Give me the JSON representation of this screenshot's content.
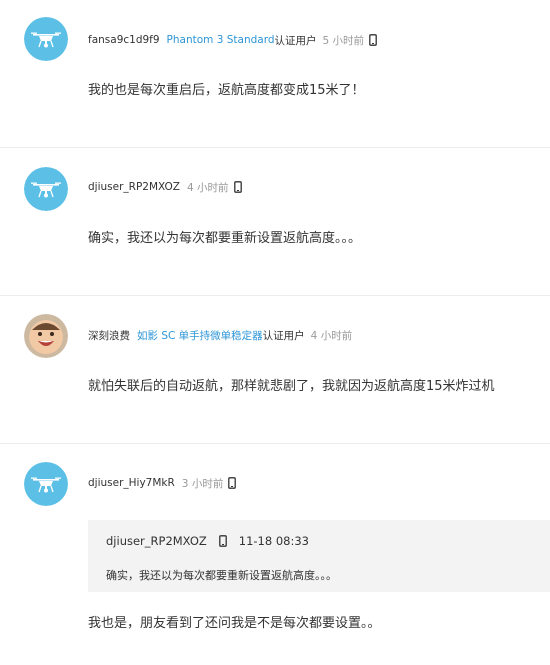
{
  "comments": [
    {
      "username": "fansa9c1d9f9",
      "device": "Phantom 3 Standard",
      "badge": "认证用户",
      "time": "5 小时前",
      "avatar": "drone-avatar-icon",
      "text": "我的也是每次重启后，返航高度都变成15米了！"
    },
    {
      "username": "djiuser_RP2MXOZ",
      "device": "",
      "badge": "",
      "time": "4 小时前",
      "avatar": "drone-avatar-icon",
      "text": "确实，我还以为每次都要重新设置返航高度。。。"
    },
    {
      "username": "深刻浪费",
      "device": "如影 SC 单手持微单稳定器",
      "badge": "认证用户",
      "time": "4 小时前",
      "avatar": "baby-face-avatar-icon",
      "text": "就怕失联后的自动返航，那样就悲剧了，我就因为返航高度15米炸过机"
    },
    {
      "username": "djiuser_Hiy7MkR",
      "device": "",
      "badge": "",
      "time": "3 小时前",
      "avatar": "drone-avatar-icon",
      "quote": {
        "username": "djiuser_RP2MXOZ",
        "time": "11-18 08:33",
        "text": "确实，我还以为每次都要重新设置返航高度。。。"
      },
      "text": "我也是，朋友看到了还问我是不是每次都要设置。。"
    }
  ],
  "colors": {
    "link": "#2d95d6",
    "muted": "#999999",
    "quote_bg": "#f3f3f3",
    "divider": "#ececec",
    "avatar_bg": "#5bbfe6"
  }
}
